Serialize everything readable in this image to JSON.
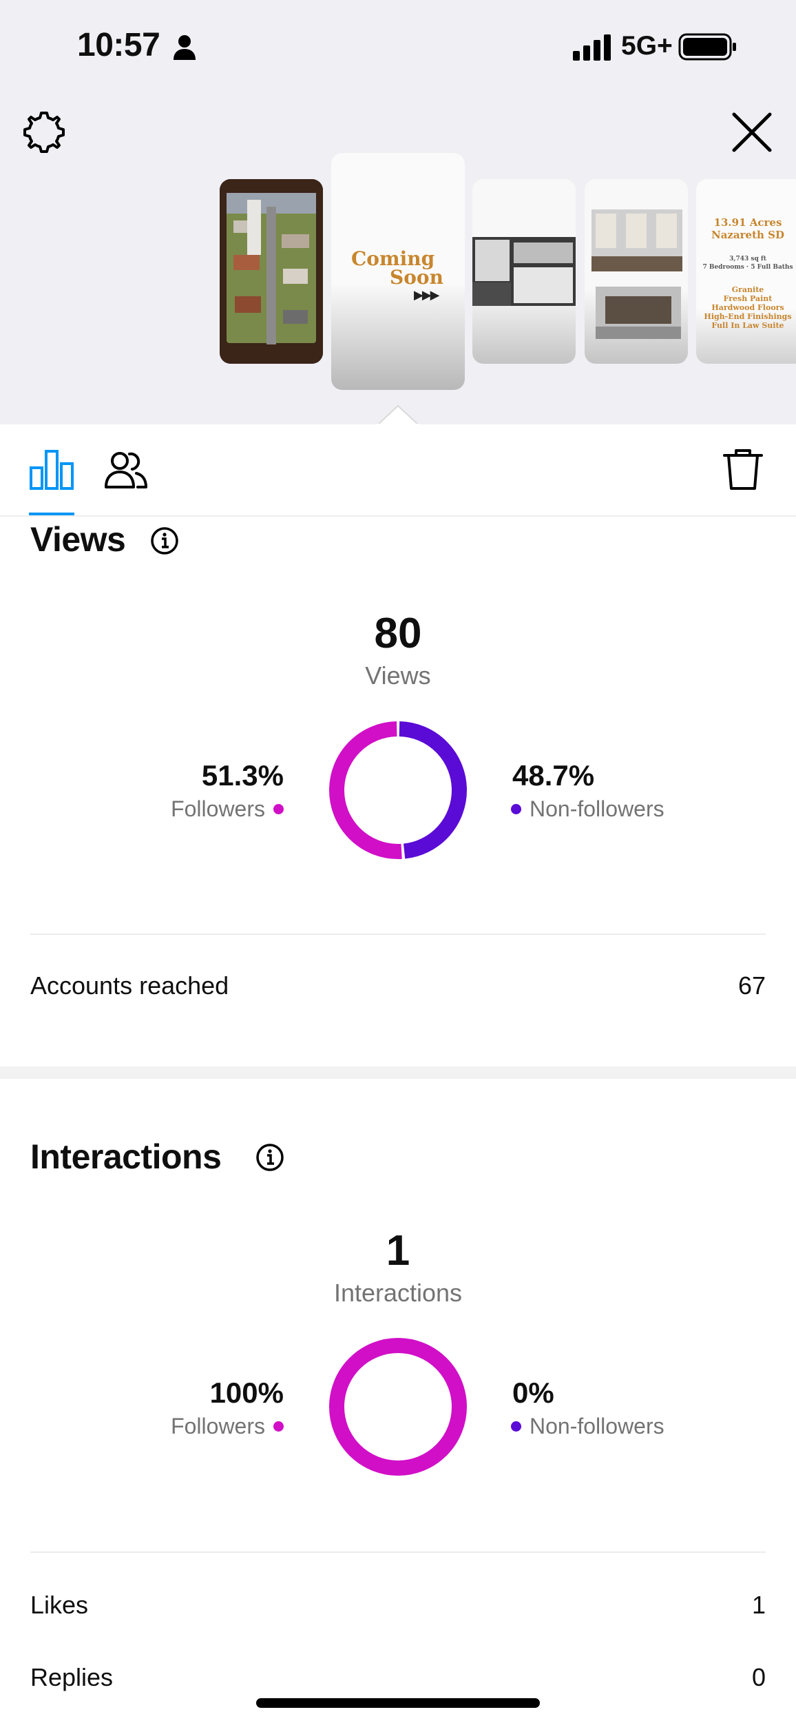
{
  "status_bar": {
    "time": "10:57",
    "network": "5G+"
  },
  "story_thumbnails": {
    "coming_soon_line1": "Coming",
    "coming_soon_line2": "Soon",
    "coming_soon_arrows": "▶▶▶",
    "promo_title": "13.91 Acres\nNazareth SD",
    "promo_details": "3,743 sq ft\n7 Bedrooms · 5 Full Baths",
    "promo_features": "Granite\nFresh Paint\nHardwood Floors\nHigh-End Finishings\nFull In Law Suite"
  },
  "views": {
    "title": "Views",
    "total": "80",
    "total_label": "Views",
    "followers_pct": "51.3%",
    "followers_label": "Followers",
    "nonfollowers_pct": "48.7%",
    "nonfollowers_label": "Non-followers",
    "followers_share": 0.513,
    "accounts_reached_label": "Accounts reached",
    "accounts_reached_value": "67"
  },
  "interactions": {
    "title": "Interactions",
    "total": "1",
    "total_label": "Interactions",
    "followers_pct": "100%",
    "followers_label": "Followers",
    "nonfollowers_pct": "0%",
    "nonfollowers_label": "Non-followers",
    "followers_share": 1.0,
    "likes_label": "Likes",
    "likes_value": "1",
    "replies_label": "Replies",
    "replies_value": "0"
  },
  "colors": {
    "followers": "#d10fc7",
    "nonfollowers": "#5a0bd6",
    "accent": "#0095f6"
  },
  "icons": [
    "person-icon",
    "signal-icon",
    "battery-icon",
    "settings-gear-icon",
    "close-icon",
    "insights-bar-chart-icon",
    "people-icon",
    "trash-icon",
    "info-icon"
  ]
}
